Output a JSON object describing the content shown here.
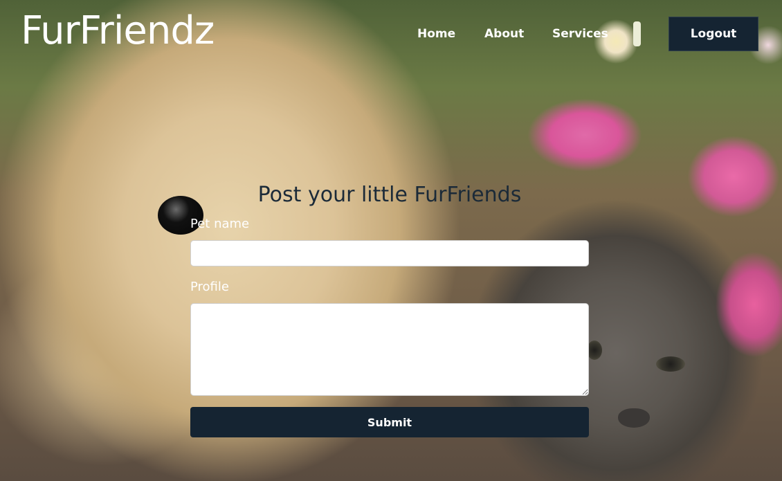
{
  "header": {
    "logo": "FurFriendz",
    "nav": {
      "home": "Home",
      "about": "About",
      "services": "Services"
    },
    "logout_label": "Logout"
  },
  "form": {
    "title": "Post your little FurFriends",
    "pet_name_label": "Pet name",
    "pet_name_value": "",
    "profile_label": "Profile",
    "profile_value": "",
    "submit_label": "Submit"
  },
  "background": {
    "subject": "puppy and kitten photo",
    "accent_dark": "#152432",
    "title_color": "#1b2a38"
  }
}
